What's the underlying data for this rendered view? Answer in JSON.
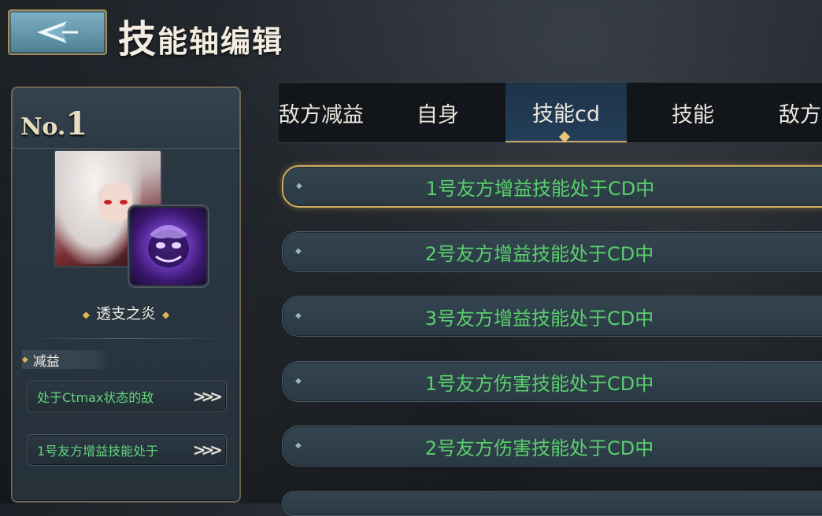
{
  "header": {
    "title_first": "技",
    "title_rest": "能轴编辑"
  },
  "left_panel": {
    "no_prefix": "No.",
    "no_number": "1",
    "character_name": "透支之炎",
    "section_label": "减益",
    "conditions": [
      {
        "label": "处于Ctmax状态的敌"
      },
      {
        "label": "1号友方增益技能处于"
      }
    ]
  },
  "tabs": [
    {
      "label": "敌方减益",
      "active": false
    },
    {
      "label": "自身",
      "active": false
    },
    {
      "label": "技能cd",
      "active": true
    },
    {
      "label": "技能",
      "active": false
    },
    {
      "label": "敌方",
      "active": false
    }
  ],
  "condition_list": [
    {
      "label": "1号友方增益技能处于CD中",
      "selected": true
    },
    {
      "label": "2号友方增益技能处于CD中",
      "selected": false
    },
    {
      "label": "3号友方增益技能处于CD中",
      "selected": false
    },
    {
      "label": "1号友方伤害技能处于CD中",
      "selected": false
    },
    {
      "label": "2号友方伤害技能处于CD中",
      "selected": false
    }
  ],
  "colors": {
    "accent_gold": "#d1ae5f",
    "condition_text": "#5ad06c",
    "active_tab": "#233e59"
  },
  "icons": {
    "back": "arrow-back-icon",
    "more": "triple-chevron-right-icon"
  }
}
